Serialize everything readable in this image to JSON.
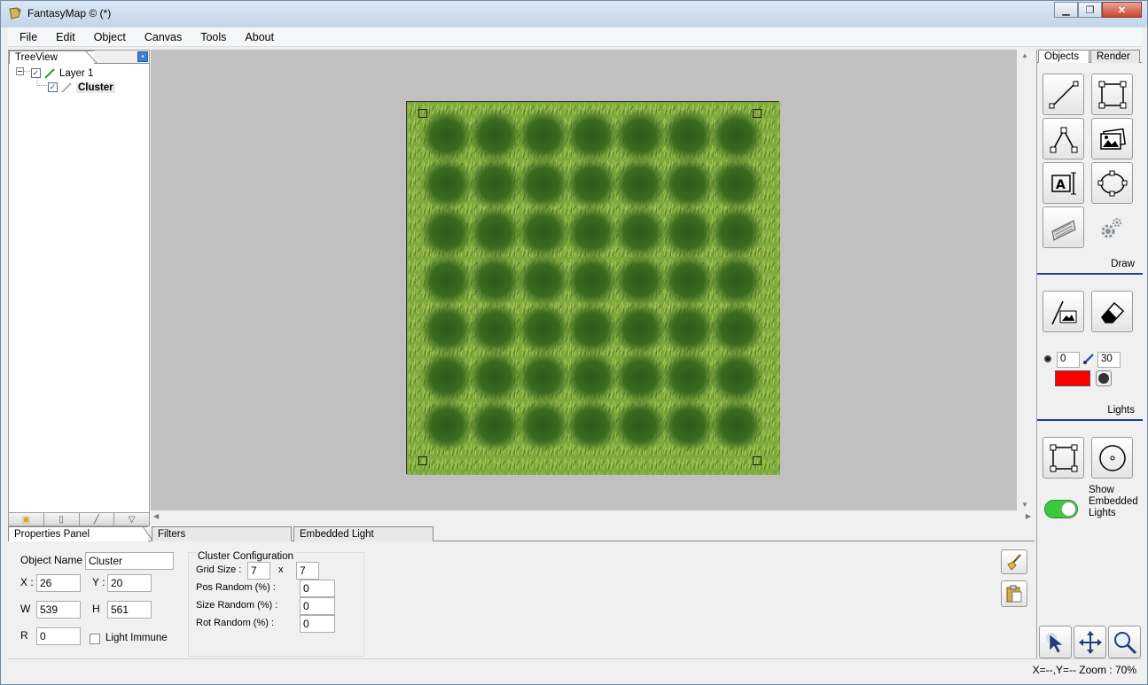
{
  "window": {
    "title": "FantasyMap © (*)"
  },
  "menu": {
    "items": [
      "File",
      "Edit",
      "Object",
      "Canvas",
      "Tools",
      "About"
    ]
  },
  "treeview": {
    "tab_label": "TreeView",
    "nodes": [
      {
        "label": "Layer 1",
        "checked": true,
        "icon": "pencil-icon"
      },
      {
        "label": "Cluster",
        "checked": true,
        "icon": "pencil-outline-icon"
      }
    ]
  },
  "canvas": {
    "grid_rows": 7,
    "grid_cols": 7,
    "background": "grass-texture",
    "tile_color": "#2f5a18"
  },
  "right_panel": {
    "tabs": [
      "Objects",
      "Render"
    ],
    "sections": {
      "draw": "Draw",
      "lights": "Lights"
    },
    "brush_size": "0",
    "brush_strength": "30",
    "light_color": "#ff0000",
    "show_embedded_lights_label": "Show Embedded Lights",
    "toggle_on": true,
    "toggle_color": "#3ac93a"
  },
  "bottom_tabs": [
    "Properties Panel",
    "Filters",
    "Embedded Light"
  ],
  "properties": {
    "object_name_label": "Object Name",
    "object_name": "Cluster",
    "x_label": "X :",
    "x": "26",
    "y_label": "Y :",
    "y": "20",
    "w_label": "W",
    "w": "539",
    "h_label": "H",
    "h": "561",
    "r_label": "R",
    "r": "0",
    "light_immune_label": "Light Immune",
    "light_immune_checked": false
  },
  "cluster": {
    "title": "Cluster Configuration",
    "grid_size_label": "Grid Size :",
    "grid_x": "7",
    "x_sep": "x",
    "grid_y": "7",
    "pos_random_label": "Pos Random (%) :",
    "pos_random": "0",
    "size_random_label": "Size Random (%) :",
    "size_random": "0",
    "rot_random_label": "Rot Random (%) :",
    "rot_random": "0"
  },
  "status": {
    "text": "X=--,Y=--   Zoom : 70%"
  }
}
